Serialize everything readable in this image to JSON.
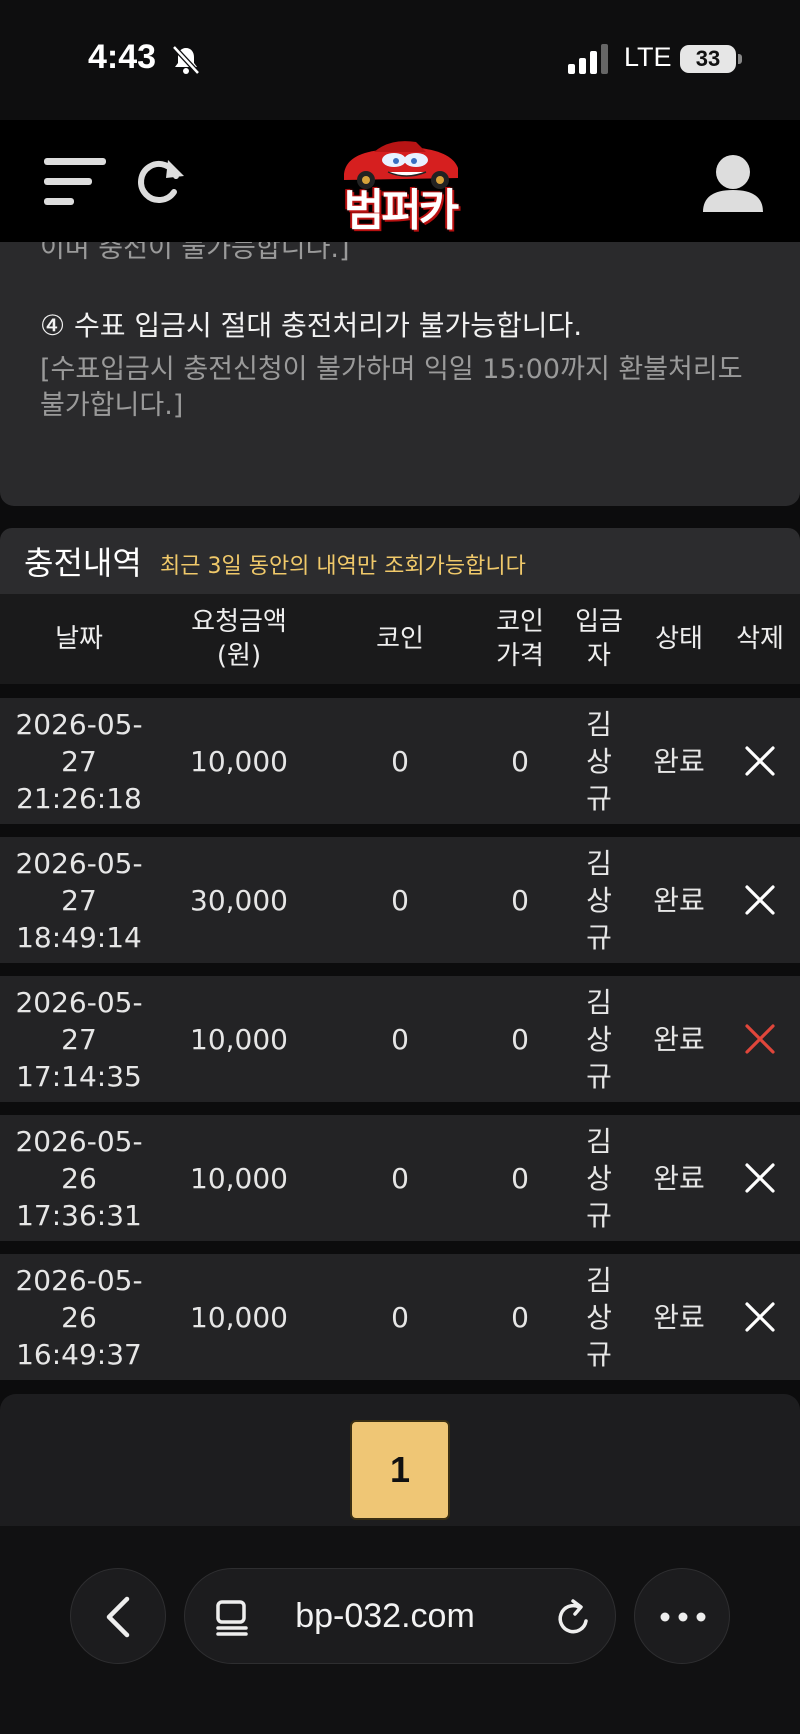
{
  "status_bar": {
    "time": "4:43",
    "network": "LTE",
    "battery": "33"
  },
  "header": {
    "logo_text": "범퍼카",
    "icons": [
      "menu-icon",
      "refresh-icon",
      "user-icon"
    ]
  },
  "notice": {
    "cut_line": "이며 충전이 불가능합니다.]",
    "item4_title": "④ 수표 입금시 절대 충전처리가 불가능합니다.",
    "item4_desc": "[수표입금시 충전신청이 불가하며 익일 15:00까지 환불처리도 불가합니다.]"
  },
  "history": {
    "title": "충전내역",
    "note": "최근 3일 동안의 내역만 조회가능합니다",
    "columns": [
      "날짜",
      "요청금액\n(원)",
      "코인",
      "코인\n가격",
      "입금\n자",
      "상태",
      "삭제"
    ],
    "rows": [
      {
        "date": "2026-05-27 21:26:18",
        "amount": "10,000",
        "coin": "0",
        "price": "0",
        "depositor": "김상규",
        "status": "완료",
        "delete_color": "#ffffff"
      },
      {
        "date": "2026-05-27 18:49:14",
        "amount": "30,000",
        "coin": "0",
        "price": "0",
        "depositor": "김상규",
        "status": "완료",
        "delete_color": "#ffffff"
      },
      {
        "date": "2026-05-27 17:14:35",
        "amount": "10,000",
        "coin": "0",
        "price": "0",
        "depositor": "김상규",
        "status": "완료",
        "delete_color": "#e0463b"
      },
      {
        "date": "2026-05-26 17:36:31",
        "amount": "10,000",
        "coin": "0",
        "price": "0",
        "depositor": "김상규",
        "status": "완료",
        "delete_color": "#ffffff"
      },
      {
        "date": "2026-05-26 16:49:37",
        "amount": "10,000",
        "coin": "0",
        "price": "0",
        "depositor": "김상규",
        "status": "완료",
        "delete_color": "#ffffff"
      }
    ]
  },
  "pagination": {
    "current_page": "1"
  },
  "browser": {
    "url": "bp-032.com",
    "icons": [
      "back-icon",
      "tabs-icon",
      "reload-icon",
      "more-icon"
    ]
  },
  "colors": {
    "accent_note": "#f0c96a",
    "page_button": "#efc675",
    "delete_active": "#e0463b"
  }
}
